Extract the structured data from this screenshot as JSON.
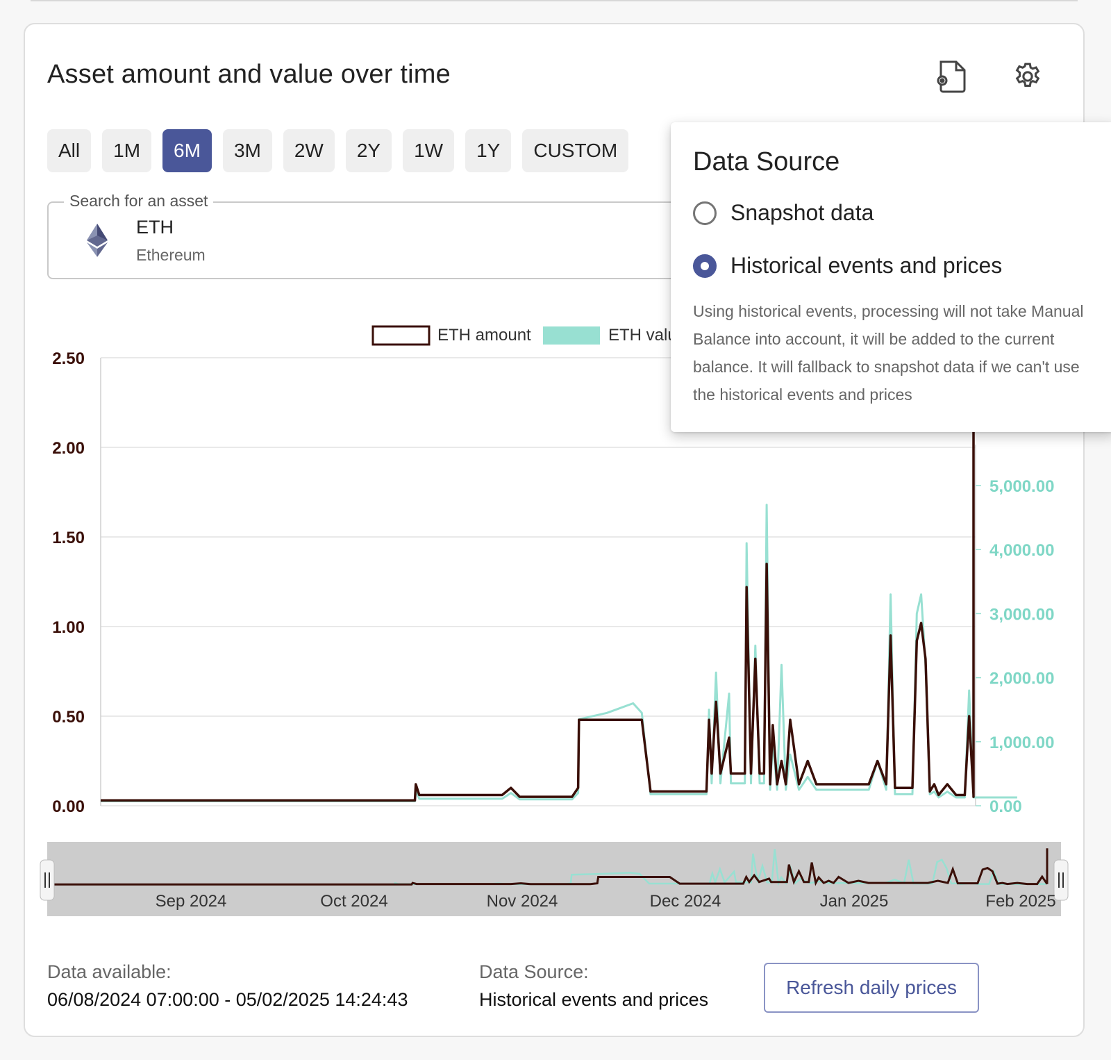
{
  "card": {
    "title": "Asset amount and value over time"
  },
  "ranges": [
    {
      "label": "All",
      "active": false
    },
    {
      "label": "1M",
      "active": false
    },
    {
      "label": "6M",
      "active": true
    },
    {
      "label": "3M",
      "active": false
    },
    {
      "label": "2W",
      "active": false
    },
    {
      "label": "2Y",
      "active": false
    },
    {
      "label": "1W",
      "active": false
    },
    {
      "label": "1Y",
      "active": false
    },
    {
      "label": "CUSTOM",
      "active": false
    }
  ],
  "search": {
    "legend": "Search for an asset",
    "symbol": "ETH",
    "name": "Ethereum"
  },
  "icons": {
    "export": "file-settings-icon",
    "settings": "gear-icon",
    "asset": "ethereum-icon"
  },
  "colors": {
    "accent": "#4a5799",
    "amount": "#3a0f08",
    "value": "#98e0d2"
  },
  "popover": {
    "title": "Data Source",
    "options": [
      {
        "label": "Snapshot data",
        "checked": false
      },
      {
        "label": "Historical events and prices",
        "checked": true
      }
    ],
    "description": "Using historical events, processing will not take Manual Balance into account, it will be added to the current balance. It will fallback to snapshot data if we can't use the historical events and prices"
  },
  "chart_data": {
    "type": "line",
    "legend": [
      "ETH amount",
      "ETH value"
    ],
    "left_axis": {
      "ticks": [
        "0.00",
        "0.50",
        "1.00",
        "1.50",
        "2.00",
        "2.50"
      ],
      "range": [
        0,
        2.5
      ]
    },
    "right_axis": {
      "ticks": [
        "0.00",
        "1,000.00",
        "2,000.00",
        "3,000.00",
        "4,000.00",
        "5,000.00"
      ],
      "range": [
        0,
        5000
      ]
    },
    "x_ticks": [
      "Sep 2024",
      "Oct 2024",
      "Nov 2024",
      "Dec 2024",
      "Jan 2025",
      "Feb 2025"
    ],
    "series": [
      {
        "name": "ETH amount",
        "points": [
          [
            0,
            0.03
          ],
          [
            0.36,
            0.03
          ],
          [
            0.361,
            0.12
          ],
          [
            0.365,
            0.06
          ],
          [
            0.46,
            0.06
          ],
          [
            0.47,
            0.1
          ],
          [
            0.48,
            0.05
          ],
          [
            0.54,
            0.05
          ],
          [
            0.547,
            0.1
          ],
          [
            0.548,
            0.48
          ],
          [
            0.62,
            0.48
          ],
          [
            0.63,
            0.08
          ],
          [
            0.694,
            0.08
          ],
          [
            0.697,
            0.48
          ],
          [
            0.7,
            0.18
          ],
          [
            0.705,
            0.58
          ],
          [
            0.71,
            0.18
          ],
          [
            0.72,
            0.38
          ],
          [
            0.722,
            0.18
          ],
          [
            0.738,
            0.18
          ],
          [
            0.74,
            1.22
          ],
          [
            0.745,
            0.18
          ],
          [
            0.75,
            0.82
          ],
          [
            0.755,
            0.18
          ],
          [
            0.76,
            0.18
          ],
          [
            0.763,
            1.35
          ],
          [
            0.767,
            0.12
          ],
          [
            0.77,
            0.45
          ],
          [
            0.775,
            0.12
          ],
          [
            0.78,
            0.25
          ],
          [
            0.785,
            0.12
          ],
          [
            0.79,
            0.48
          ],
          [
            0.8,
            0.12
          ],
          [
            0.81,
            0.25
          ],
          [
            0.82,
            0.12
          ],
          [
            0.88,
            0.12
          ],
          [
            0.89,
            0.25
          ],
          [
            0.9,
            0.12
          ],
          [
            0.905,
            0.95
          ],
          [
            0.91,
            0.1
          ],
          [
            0.93,
            0.1
          ],
          [
            0.935,
            0.92
          ],
          [
            0.94,
            1.02
          ],
          [
            0.945,
            0.82
          ],
          [
            0.95,
            0.08
          ],
          [
            0.955,
            0.12
          ],
          [
            0.96,
            0.06
          ],
          [
            0.97,
            0.12
          ],
          [
            0.98,
            0.06
          ],
          [
            0.99,
            0.06
          ],
          [
            0.995,
            0.5
          ],
          [
            1.0,
            0.06
          ],
          [
            1.05,
            0.06
          ],
          [
            1.052,
            0.05
          ],
          [
            1.06,
            2.2
          ]
        ]
      },
      {
        "name": "ETH value",
        "points": [
          [
            0,
            70
          ],
          [
            0.36,
            70
          ],
          [
            0.361,
            250
          ],
          [
            0.365,
            110
          ],
          [
            0.46,
            110
          ],
          [
            0.47,
            200
          ],
          [
            0.48,
            100
          ],
          [
            0.54,
            100
          ],
          [
            0.547,
            200
          ],
          [
            0.548,
            1350
          ],
          [
            0.58,
            1450
          ],
          [
            0.61,
            1600
          ],
          [
            0.62,
            1450
          ],
          [
            0.63,
            180
          ],
          [
            0.694,
            180
          ],
          [
            0.697,
            1500
          ],
          [
            0.7,
            350
          ],
          [
            0.705,
            2080
          ],
          [
            0.71,
            350
          ],
          [
            0.72,
            1750
          ],
          [
            0.722,
            350
          ],
          [
            0.738,
            350
          ],
          [
            0.74,
            4100
          ],
          [
            0.745,
            350
          ],
          [
            0.75,
            2500
          ],
          [
            0.755,
            350
          ],
          [
            0.76,
            350
          ],
          [
            0.763,
            4700
          ],
          [
            0.767,
            250
          ],
          [
            0.77,
            1000
          ],
          [
            0.775,
            250
          ],
          [
            0.78,
            2200
          ],
          [
            0.785,
            250
          ],
          [
            0.79,
            800
          ],
          [
            0.8,
            250
          ],
          [
            0.81,
            450
          ],
          [
            0.82,
            250
          ],
          [
            0.88,
            250
          ],
          [
            0.89,
            700
          ],
          [
            0.9,
            250
          ],
          [
            0.905,
            3300
          ],
          [
            0.91,
            180
          ],
          [
            0.93,
            180
          ],
          [
            0.935,
            3000
          ],
          [
            0.94,
            3300
          ],
          [
            0.945,
            2200
          ],
          [
            0.95,
            180
          ],
          [
            0.955,
            220
          ],
          [
            0.96,
            130
          ],
          [
            0.97,
            220
          ],
          [
            0.98,
            130
          ],
          [
            0.99,
            130
          ],
          [
            0.995,
            1800
          ],
          [
            1.0,
            130
          ],
          [
            1.05,
            130
          ]
        ]
      }
    ]
  },
  "footer": {
    "available_label": "Data available:",
    "available_value": "06/08/2024 07:00:00 - 05/02/2025 14:24:43",
    "source_label": "Data Source:",
    "source_value": "Historical events and prices",
    "refresh_label": "Refresh daily prices"
  }
}
